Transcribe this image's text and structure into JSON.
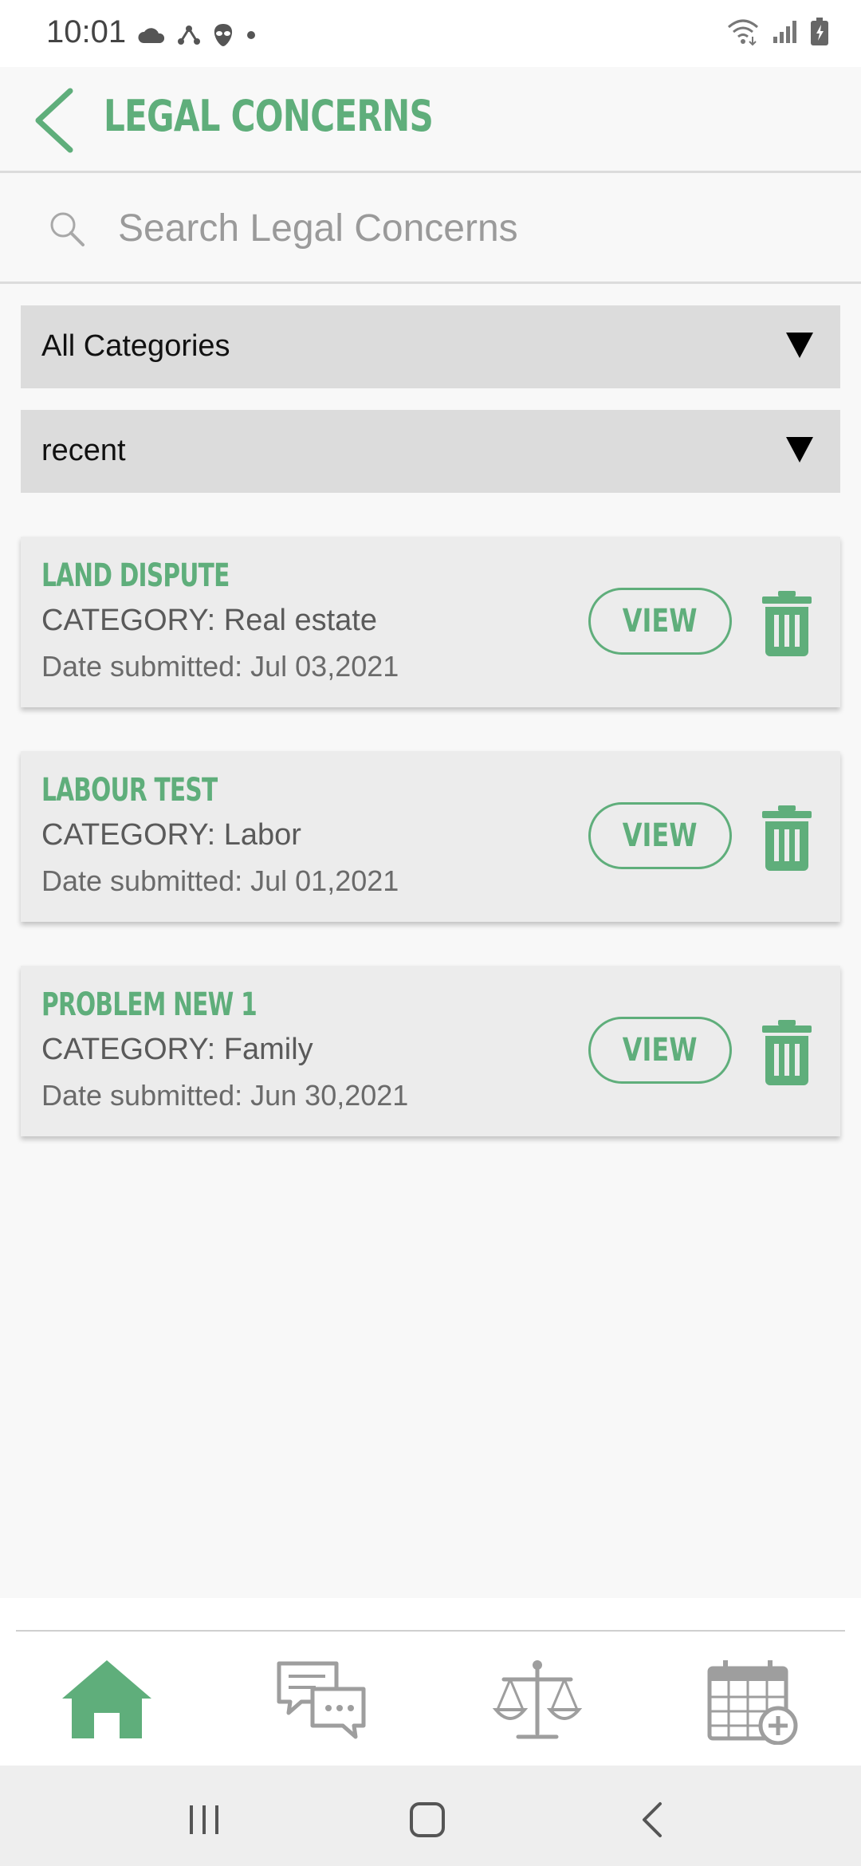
{
  "status_bar": {
    "time": "10:01",
    "icons_left": [
      "cloud-icon",
      "network-icon",
      "alien-icon",
      "dot-icon"
    ],
    "icons_right": [
      "wifi-icon",
      "signal-icon",
      "battery-icon"
    ]
  },
  "header": {
    "title": "LEGAL CONCERNS",
    "back_icon": "chevron-left-icon"
  },
  "search": {
    "placeholder": "Search Legal Concerns",
    "value": ""
  },
  "filters": {
    "category": "All Categories",
    "sort": "recent"
  },
  "concerns": [
    {
      "title": "LAND DISPUTE",
      "category": "CATEGORY: Real estate",
      "date": "Date submitted: Jul 03,2021",
      "view_label": "VIEW"
    },
    {
      "title": "LABOUR TEST",
      "category": "CATEGORY: Labor",
      "date": "Date submitted: Jul 01,2021",
      "view_label": "VIEW"
    },
    {
      "title": "PROBLEM NEW 1",
      "category": "CATEGORY: Family",
      "date": "Date submitted: Jun 30,2021",
      "view_label": "VIEW"
    }
  ],
  "bottom_nav": {
    "items": [
      "home-icon",
      "chat-icon",
      "scales-icon",
      "calendar-add-icon"
    ],
    "active": "home-icon"
  },
  "colors": {
    "accent": "#5fae7b",
    "inactive_icon": "#9e9e9e",
    "dropdown_bg": "#dcdcdc",
    "card_bg": "#ececec"
  }
}
